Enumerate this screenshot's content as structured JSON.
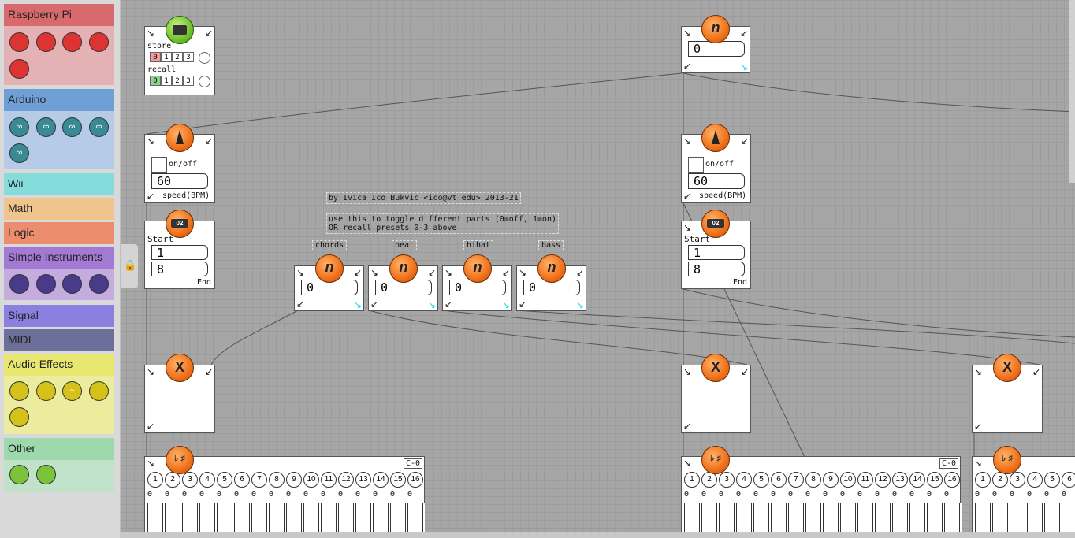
{
  "sidebar": {
    "categories": [
      {
        "label": "Raspberry Pi",
        "color": "#d8696d",
        "body": "#e4b2b4"
      },
      {
        "label": "Arduino",
        "color": "#6f9fd7",
        "body": "#b6cbe8"
      },
      {
        "label": "Wii",
        "color": "#84dcdb"
      },
      {
        "label": "Math",
        "color": "#f0c58d"
      },
      {
        "label": "Logic",
        "color": "#ec8d6d"
      },
      {
        "label": "Simple Instruments",
        "color": "#a27ad3",
        "body": "#c5acdf"
      },
      {
        "label": "Signal",
        "color": "#8b7fe0"
      },
      {
        "label": "MIDI",
        "color": "#6d6f9b"
      },
      {
        "label": "Audio Effects",
        "color": "#e8e871",
        "body": "#ecec9f"
      },
      {
        "label": "Other",
        "color": "#9ed9ad",
        "body": "#bfe2c8"
      }
    ]
  },
  "presets": {
    "store": "store",
    "recall": "recall",
    "slots": [
      "0",
      "1",
      "2",
      "3"
    ]
  },
  "metro_left": {
    "onoff": "on/off",
    "value": "60",
    "speed": "speed(BPM)"
  },
  "metro_right": {
    "onoff": "on/off",
    "value": "60",
    "speed": "speed(BPM)"
  },
  "counter_left": {
    "start": "Start",
    "start_value": "1",
    "end_value": "8",
    "end": "End",
    "icon": "02"
  },
  "counter_right": {
    "start": "Start",
    "start_value": "1",
    "end_value": "8",
    "end": "End",
    "icon": "02"
  },
  "top_number": {
    "value": "0"
  },
  "notes": {
    "author": "by Ivica Ico Bukvic <ico@vt.edu> 2013-21",
    "usage": "use this to toggle different parts (0=off, 1=on)\nOR recall presets 0-3 above"
  },
  "parts": [
    {
      "label": "chords",
      "value": "0"
    },
    {
      "label": "beat",
      "value": "0"
    },
    {
      "label": "hihat",
      "value": "0"
    },
    {
      "label": "bass",
      "value": "0"
    }
  ],
  "multiply_symbol": "X",
  "piano": {
    "note_label": "C-0",
    "keys": [
      "1",
      "2",
      "3",
      "4",
      "5",
      "6",
      "7",
      "8",
      "9",
      "10",
      "11",
      "12",
      "13",
      "14",
      "15",
      "16"
    ],
    "values": [
      "0",
      "0",
      "0",
      "0",
      "0",
      "0",
      "0",
      "0",
      "0",
      "0",
      "0",
      "0",
      "0",
      "0",
      "0",
      "0"
    ]
  },
  "colors": {
    "accent": "#f0701a",
    "cyan": "#14d6e0",
    "grid": "#a6a6a6"
  }
}
